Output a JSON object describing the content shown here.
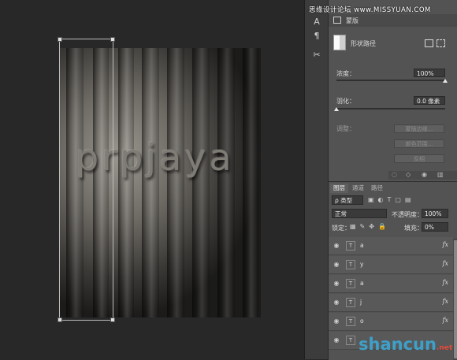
{
  "artwork": {
    "text": "prpjaya"
  },
  "toolstrip": {
    "tools": [
      {
        "glyph": "A",
        "icon": "character-icon"
      },
      {
        "glyph": "¶",
        "icon": "paragraph-icon"
      },
      {
        "glyph": "✂",
        "icon": "tools-icon"
      }
    ]
  },
  "properties": {
    "header": "蒙版",
    "mask_type": "形状路径",
    "density_label": "浓度：",
    "density_value": "100%",
    "density_level": 1.0,
    "feather_label": "羽化：",
    "feather_value": "0.0 像素",
    "feather_level": 0.0,
    "adjust_label": "调整：",
    "buttons": [
      "蒙版边缘...",
      "颜色范围...",
      "反相"
    ]
  },
  "layers": {
    "tabs": [
      "图层",
      "通道",
      "路径"
    ],
    "filter_kind": "ρ 类型",
    "blend_mode": "正常",
    "opacity_label": "不透明度：",
    "opacity_value": "100%",
    "lock_label": "锁定：",
    "fill_label": "填充：",
    "fill_value": "0%",
    "rows": [
      {
        "name": "a",
        "fx": "fx"
      },
      {
        "name": "y",
        "fx": "fx"
      },
      {
        "name": "a",
        "fx": "fx"
      },
      {
        "name": "j",
        "fx": "fx"
      },
      {
        "name": "o",
        "fx": "fx"
      },
      {
        "name": "",
        "fx": ""
      }
    ]
  },
  "watermarks": {
    "top": "思缘设计论坛 www.MISSYUAN.COM",
    "bottom_main": "shancun",
    "bottom_net": ".net"
  },
  "colors": {
    "canvas_bg": "#282828",
    "panel_bg": "#535353",
    "watermark_blue": "#3ea0c8",
    "watermark_red": "#e34a3a"
  }
}
